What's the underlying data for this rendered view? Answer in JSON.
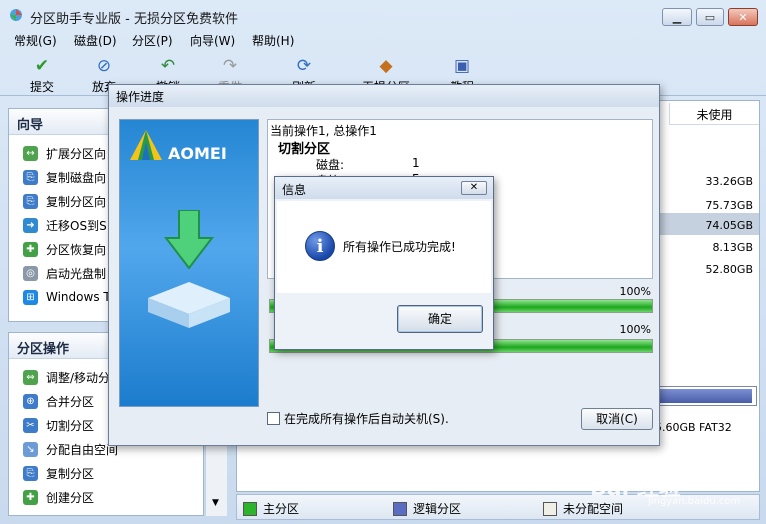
{
  "app": {
    "title": "分区助手专业版 - 无损分区免费软件"
  },
  "menu": [
    "常规(G)",
    "磁盘(D)",
    "分区(P)",
    "向导(W)",
    "帮助(H)"
  ],
  "toolbar": [
    {
      "label": "提交",
      "icon": "check-icon"
    },
    {
      "label": "放弃",
      "icon": "discard-icon"
    },
    {
      "label": "撤销",
      "icon": "undo-icon"
    },
    {
      "label": "重做",
      "icon": "redo-icon"
    },
    {
      "label": "刷新",
      "icon": "refresh-icon"
    },
    {
      "label": "无损分区",
      "icon": "partition-icon"
    },
    {
      "label": "教程",
      "icon": "tutorial-icon"
    }
  ],
  "sidebar": {
    "wizard": {
      "title": "向导",
      "items": [
        "扩展分区向",
        "复制磁盘向",
        "复制分区向",
        "迁移OS到S",
        "分区恢复向",
        "启动光盘制",
        "Windows To"
      ]
    },
    "partition_ops": {
      "title": "分区操作",
      "items": [
        "调整/移动分",
        "合并分区",
        "切割分区",
        "分配自由空间",
        "复制分区",
        "创建分区"
      ]
    }
  },
  "main": {
    "unused_header": "未使用",
    "sizes": [
      "33.26GB",
      "75.73GB",
      "74.05GB",
      "8.13GB",
      "52.80GB"
    ],
    "diskmap_label": "5.60GB FAT32"
  },
  "legend": [
    "主分区",
    "逻辑分区",
    "未分配空间"
  ],
  "colors": {
    "primary": "#2db42d",
    "logical": "#5a6dc2",
    "unallocated": "#efefe6"
  },
  "progress_dialog": {
    "title": "操作进度",
    "brand": "AOMEI",
    "current_op": "当前操作1, 总操作1",
    "op_name": "切割分区",
    "disk_label": "磁盘:",
    "disk_value": "1",
    "drive_label": "盘符:",
    "drive_value": "F:",
    "progress1_pct": "100%",
    "progress2_pct": "100%",
    "progress1_value": 1.0,
    "progress2_value": 1.0,
    "shutdown_label": "在完成所有操作后自动关机(S).",
    "cancel": "取消(C)"
  },
  "info_dialog": {
    "title": "信息",
    "message": "所有操作已成功完成!",
    "ok": "确定"
  },
  "watermark": {
    "text": "Bai 经验",
    "url": "jingyan.baidu.com"
  }
}
